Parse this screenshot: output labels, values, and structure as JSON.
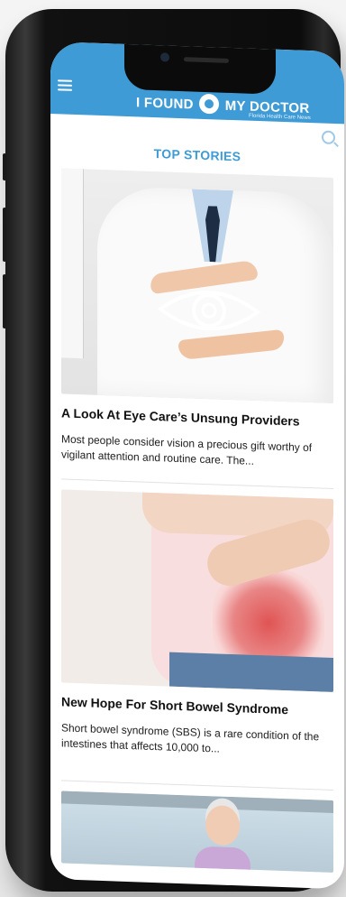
{
  "app": {
    "brand_left": "I FOUND",
    "brand_right": "MY DOCTOR",
    "brand_sub": "Florida Health Care News"
  },
  "section_title": "TOP STORIES",
  "stories": [
    {
      "title": "A Look At Eye Care’s Unsung Providers",
      "excerpt": "Most people consider vision a precious gift worthy of vigilant attention and routine care. The..."
    },
    {
      "title": "New Hope For Short Bowel Syndrome",
      "excerpt": "Short bowel syndrome (SBS) is a rare condition of the intestines that affects 10,000 to..."
    }
  ],
  "icons": {
    "menu": "menu-icon",
    "search": "search-icon",
    "logo": "doctor-logo-icon"
  },
  "colors": {
    "brand_blue": "#3f9bd6",
    "text_dark": "#111111"
  }
}
